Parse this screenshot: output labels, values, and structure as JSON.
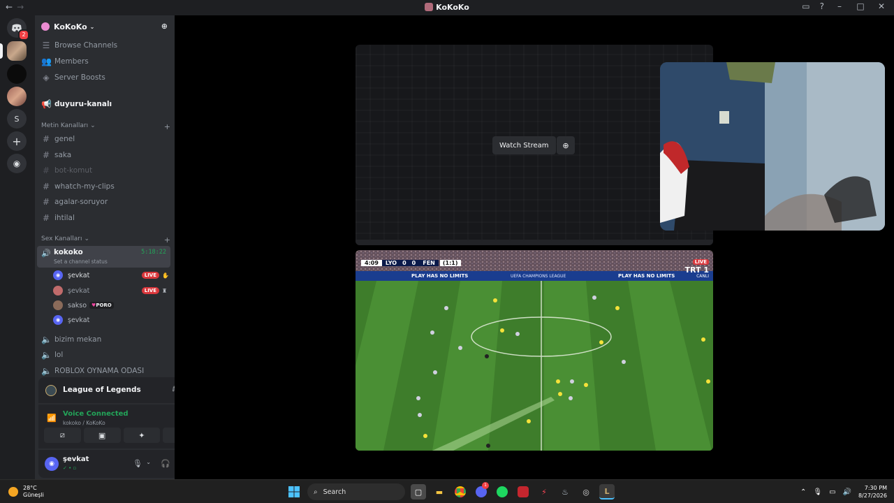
{
  "window": {
    "title": "KoKoKo"
  },
  "guilds": {
    "home_badge": "2",
    "letter_server": "S"
  },
  "server": {
    "name": "KoKoKo"
  },
  "nav": [
    {
      "icon": "list-icon",
      "label": "Browse Channels"
    },
    {
      "icon": "members-icon",
      "label": "Members"
    },
    {
      "icon": "boost-icon",
      "label": "Server Boosts"
    }
  ],
  "announcement": {
    "label": "duyuru-kanalı"
  },
  "text_category": {
    "label": "Metin Kanalları"
  },
  "text_channels": [
    {
      "label": "genel"
    },
    {
      "label": "saka"
    },
    {
      "label": "bot-komut"
    },
    {
      "label": "whatch-my-clips"
    },
    {
      "label": "agalar-soruyor"
    },
    {
      "label": "ihtilal"
    }
  ],
  "voice_category": {
    "label": "Sex Kanalları"
  },
  "active_voice": {
    "name": "kokoko",
    "status": "Set a channel status",
    "timer": "5:18:22"
  },
  "members": [
    {
      "name": "şevkat",
      "live": "LIVE"
    },
    {
      "name": "şevkat",
      "live": "LIVE"
    },
    {
      "name": "sakso",
      "tag": "PORO"
    },
    {
      "name": "şevkat"
    }
  ],
  "voice_channels": [
    {
      "label": "bizim mekan"
    },
    {
      "label": "lol"
    },
    {
      "label": "ROBLOX OYNAMA ODASI"
    }
  ],
  "activity": {
    "game": "League of Legends"
  },
  "voice_connected": {
    "title": "Voice Connected",
    "location": "kokoko / KoKoKo"
  },
  "user": {
    "name": "şevkat"
  },
  "stream": {
    "watch_label": "Watch Stream"
  },
  "scoreboard": {
    "time": "4:09",
    "home": "LYO",
    "home_score": "0",
    "away_score": "0",
    "away": "FEN",
    "agg": "(1:1)",
    "broadcaster": "TRT 1",
    "broadcaster_sub": "CANLI",
    "live": "LIVE",
    "board1": "PLAY HAS NO LIMITS",
    "board2": "UEFA CHAMPIONS LEAGUE",
    "board3": "PLAY HAS NO LIMITS"
  },
  "taskbar": {
    "temp": "28°C",
    "weather": "Güneşli",
    "search": "Search",
    "time": "7:30 PM",
    "date": "8/27/2026",
    "discord_badge": "1"
  },
  "colors": {
    "accent": "#5865f2",
    "live": "#da373c",
    "connected": "#23a559"
  }
}
